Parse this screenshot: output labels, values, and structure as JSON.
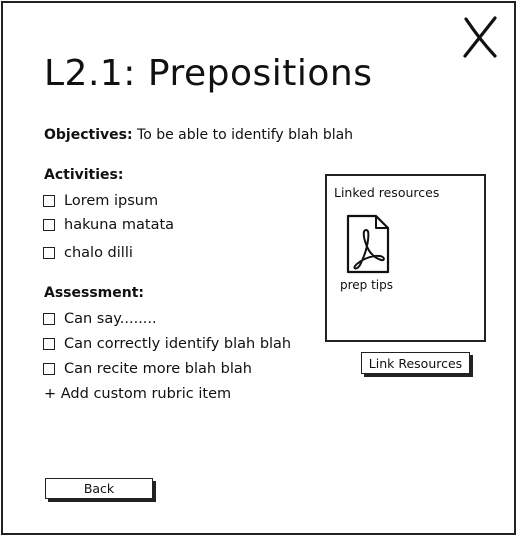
{
  "window": {
    "close_icon": "close-x-icon"
  },
  "lesson": {
    "title": "L2.1: Prepositions"
  },
  "objectives": {
    "label": "Objectives:",
    "text": "To be able to identify blah blah"
  },
  "activities": {
    "heading": "Activities:",
    "items": [
      {
        "label": "Lorem ipsum",
        "checked": false
      },
      {
        "label": "hakuna matata",
        "checked": false
      },
      {
        "label": "chalo dilli",
        "checked": false
      }
    ]
  },
  "assessment": {
    "heading": "Assessment:",
    "items": [
      {
        "label": "Can say........",
        "checked": false
      },
      {
        "label": "Can correctly identify blah blah",
        "checked": false
      },
      {
        "label": "Can recite more blah blah",
        "checked": false
      }
    ],
    "add_label": "+ Add custom rubric item"
  },
  "resources": {
    "title": "Linked resources",
    "files": [
      {
        "name": "prep tips",
        "icon": "pdf-file-icon"
      }
    ],
    "link_button_label": "Link Resources"
  },
  "footer": {
    "back_label": "Back"
  }
}
